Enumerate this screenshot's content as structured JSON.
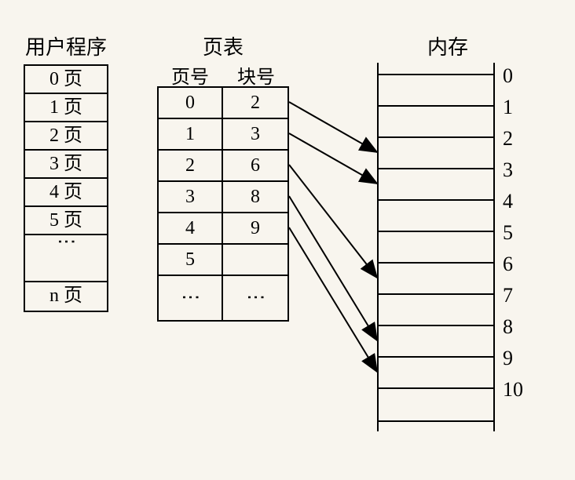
{
  "titles": {
    "user_program": "用户程序",
    "page_table": "页表",
    "memory": "内存",
    "page_no": "页号",
    "block_no": "块号"
  },
  "user_rows": [
    "0 页",
    "1 页",
    "2 页",
    "3 页",
    "4 页",
    "5 页"
  ],
  "user_last": "n 页",
  "page_table_rows": [
    {
      "page": "0",
      "block": "2"
    },
    {
      "page": "1",
      "block": "3"
    },
    {
      "page": "2",
      "block": "6"
    },
    {
      "page": "3",
      "block": "8"
    },
    {
      "page": "4",
      "block": "9"
    },
    {
      "page": "5",
      "block": ""
    }
  ],
  "memory_labels": [
    "0",
    "1",
    "2",
    "3",
    "4",
    "5",
    "6",
    "7",
    "8",
    "9",
    "10"
  ],
  "mappings": [
    {
      "from_row": 0,
      "to_block": 2
    },
    {
      "from_row": 1,
      "to_block": 3
    },
    {
      "from_row": 2,
      "to_block": 6
    },
    {
      "from_row": 3,
      "to_block": 8
    },
    {
      "from_row": 4,
      "to_block": 9
    }
  ],
  "dots": "⋮"
}
